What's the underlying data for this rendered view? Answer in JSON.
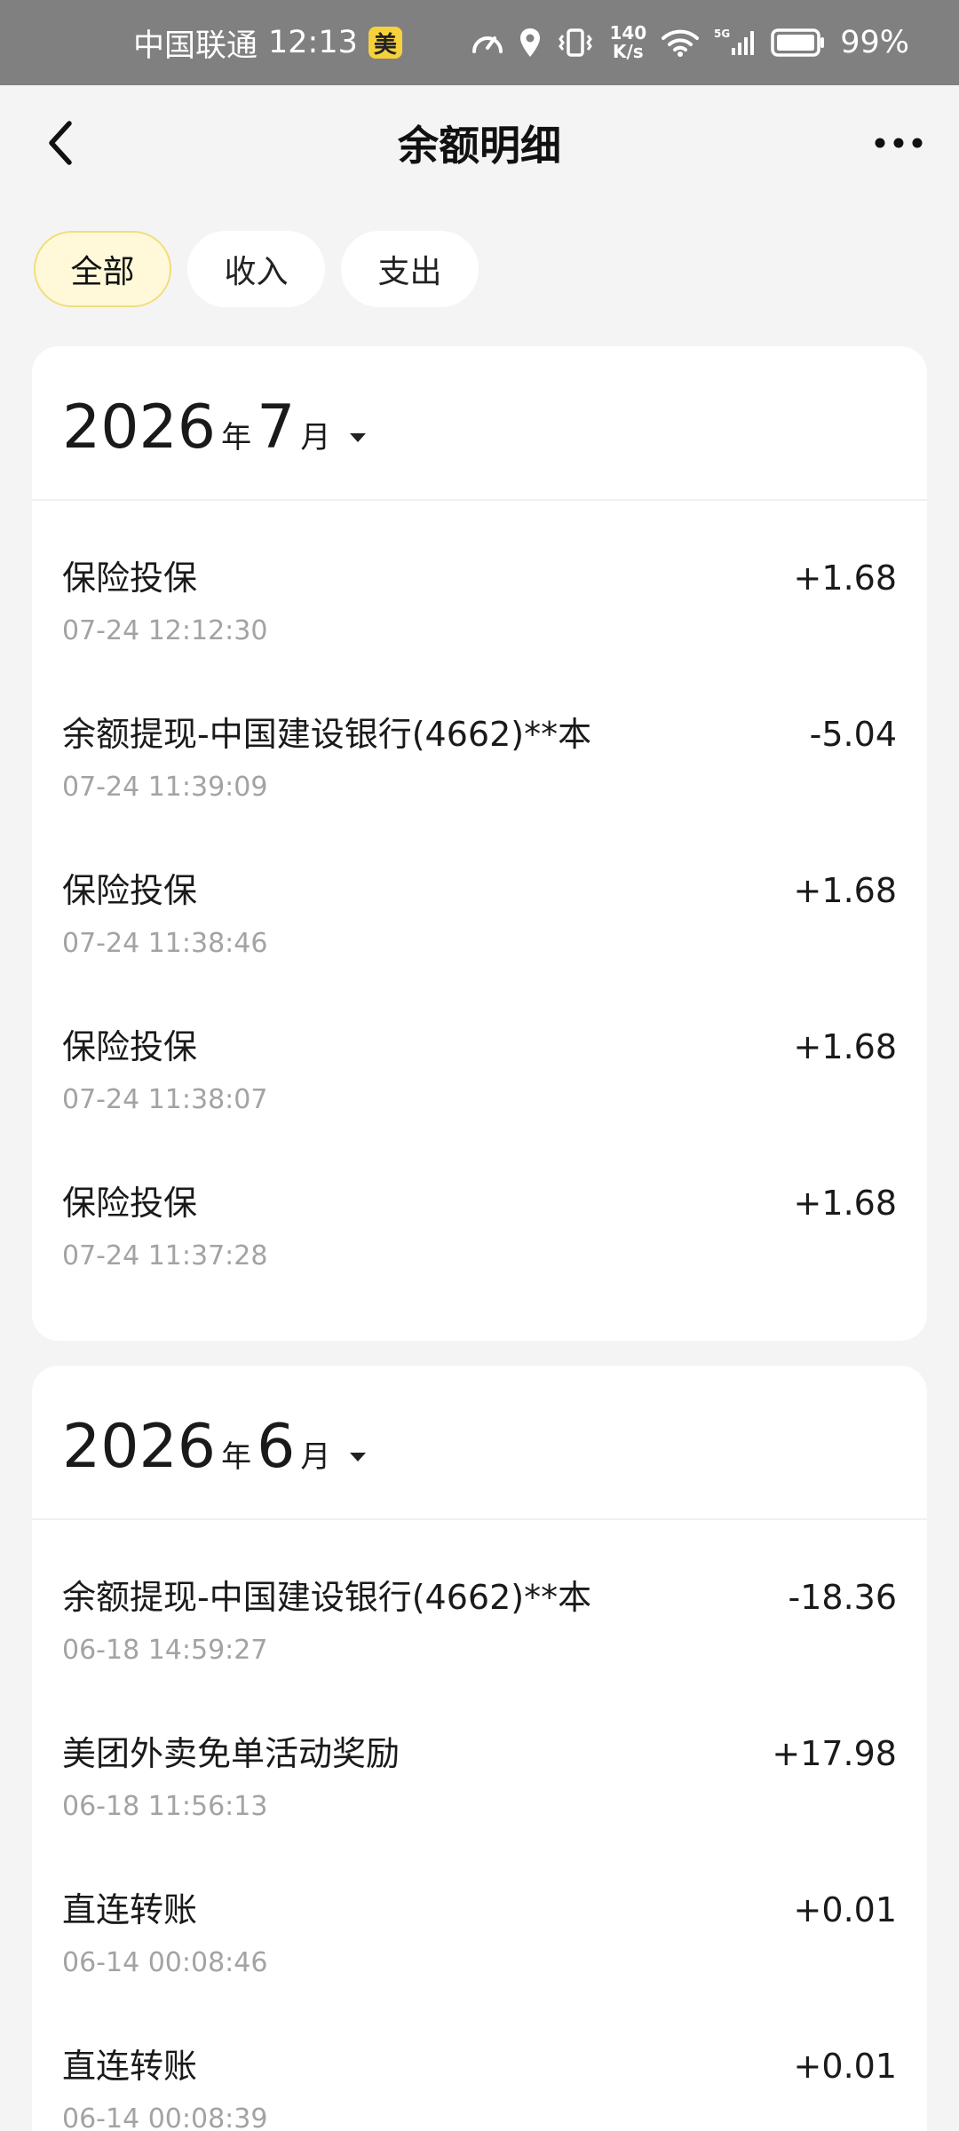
{
  "status_bar": {
    "carrier": "中国联通",
    "time": "12:13",
    "app_badge": "美",
    "net_speed_value": "140",
    "net_speed_unit": "K/s",
    "network": "5G",
    "battery": "99%"
  },
  "nav": {
    "title": "余额明细",
    "back_icon": "chevron-left-icon",
    "more_icon": "more-horizontal-icon"
  },
  "filters": [
    {
      "label": "全部",
      "active": true
    },
    {
      "label": "收入",
      "active": false
    },
    {
      "label": "支出",
      "active": false
    }
  ],
  "months": [
    {
      "year": "2026",
      "year_unit": "年",
      "month": "7",
      "month_unit": "月",
      "transactions": [
        {
          "title": "保险投保",
          "time": "07-24 12:12:30",
          "amount": "+1.68"
        },
        {
          "title": "余额提现-中国建设银行(4662)**本",
          "time": "07-24 11:39:09",
          "amount": "-5.04"
        },
        {
          "title": "保险投保",
          "time": "07-24 11:38:46",
          "amount": "+1.68"
        },
        {
          "title": "保险投保",
          "time": "07-24 11:38:07",
          "amount": "+1.68"
        },
        {
          "title": "保险投保",
          "time": "07-24 11:37:28",
          "amount": "+1.68"
        }
      ]
    },
    {
      "year": "2026",
      "year_unit": "年",
      "month": "6",
      "month_unit": "月",
      "transactions": [
        {
          "title": "余额提现-中国建设银行(4662)**本",
          "time": "06-18 14:59:27",
          "amount": "-18.36"
        },
        {
          "title": "美团外卖免单活动奖励",
          "time": "06-18 11:56:13",
          "amount": "+17.98"
        },
        {
          "title": "直连转账",
          "time": "06-14 00:08:46",
          "amount": "+0.01"
        },
        {
          "title": "直连转账",
          "time": "06-14 00:08:39",
          "amount": "+0.01"
        }
      ]
    }
  ],
  "colors": {
    "status_bar_bg": "#808080",
    "page_bg": "#f4f4f4",
    "active_tab_bg": "#fff9d9",
    "active_tab_border": "#f1de7d",
    "badge_yellow": "#f7d13c",
    "secondary_text": "#a3a3a3"
  }
}
